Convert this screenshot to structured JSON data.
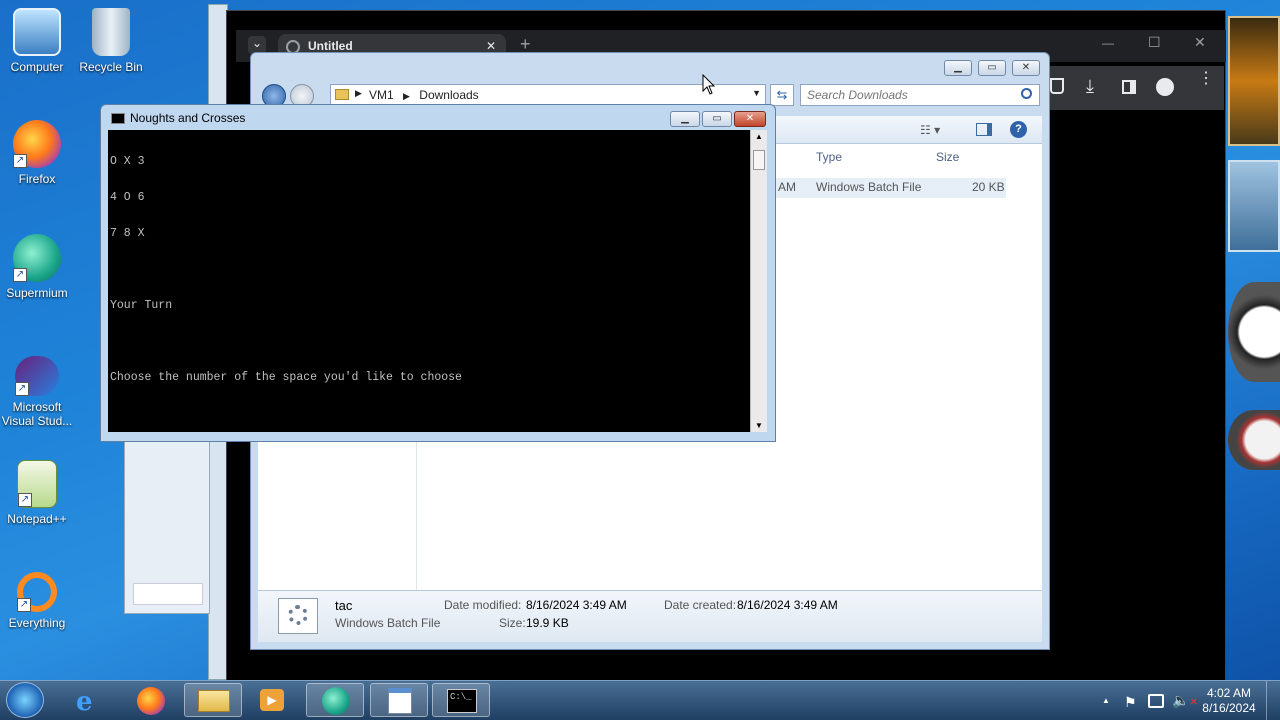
{
  "desktop": {
    "icons": [
      {
        "label": "Computer",
        "icon": "computer-icon"
      },
      {
        "label": "Recycle Bin",
        "icon": "recycle-bin-icon"
      },
      {
        "label": "Firefox",
        "icon": "firefox-icon"
      },
      {
        "label": "Supermium",
        "icon": "supermium-icon"
      },
      {
        "label": "Microsoft Visual Stud...",
        "icon": "visual-studio-icon"
      },
      {
        "label": "Notepad++",
        "icon": "notepadpp-icon"
      },
      {
        "label": "Everything",
        "icon": "everything-icon"
      }
    ]
  },
  "browser": {
    "tab_title": "Untitled",
    "tab_close": "✕",
    "new_tab": "+",
    "tab_list": "⌄",
    "window_controls": {
      "minimize": "—",
      "maximize": "☐",
      "close": "✕"
    }
  },
  "explorer": {
    "breadcrumb": [
      "VM1",
      "Downloads"
    ],
    "search_placeholder": "Search Downloads",
    "columns": {
      "type": "Type",
      "size": "Size"
    },
    "row": {
      "time_fragment": "AM",
      "type": "Windows Batch File",
      "size": "20 KB"
    },
    "details": {
      "name": "tac",
      "file_type": "Windows Batch File",
      "date_modified_label": "Date modified:",
      "date_modified": "8/16/2024 3:49 AM",
      "date_created_label": "Date created:",
      "date_created": "8/16/2024 3:49 AM",
      "size_label": "Size:",
      "size": "19.9 KB"
    }
  },
  "console": {
    "title": "Noughts and Crosses",
    "lines": [
      "O X 3",
      "4 O 6",
      "7 8 X",
      "",
      "Your Turn",
      "",
      "Choose the number of the space you'd like to choose"
    ]
  },
  "taskbar": {
    "apps": [
      "start-orb",
      "internet-explorer",
      "firefox",
      "file-explorer",
      "media-player",
      "supermium",
      "notepad",
      "command-prompt"
    ],
    "clock_time": "4:02 AM",
    "clock_date": "8/16/2024",
    "tray_arrow": "▲"
  },
  "colors": {
    "desktop_blue": "#1e83d8",
    "taskbar": "#2a4d75",
    "console_bg": "#000000",
    "console_text": "#c0c0c0"
  }
}
